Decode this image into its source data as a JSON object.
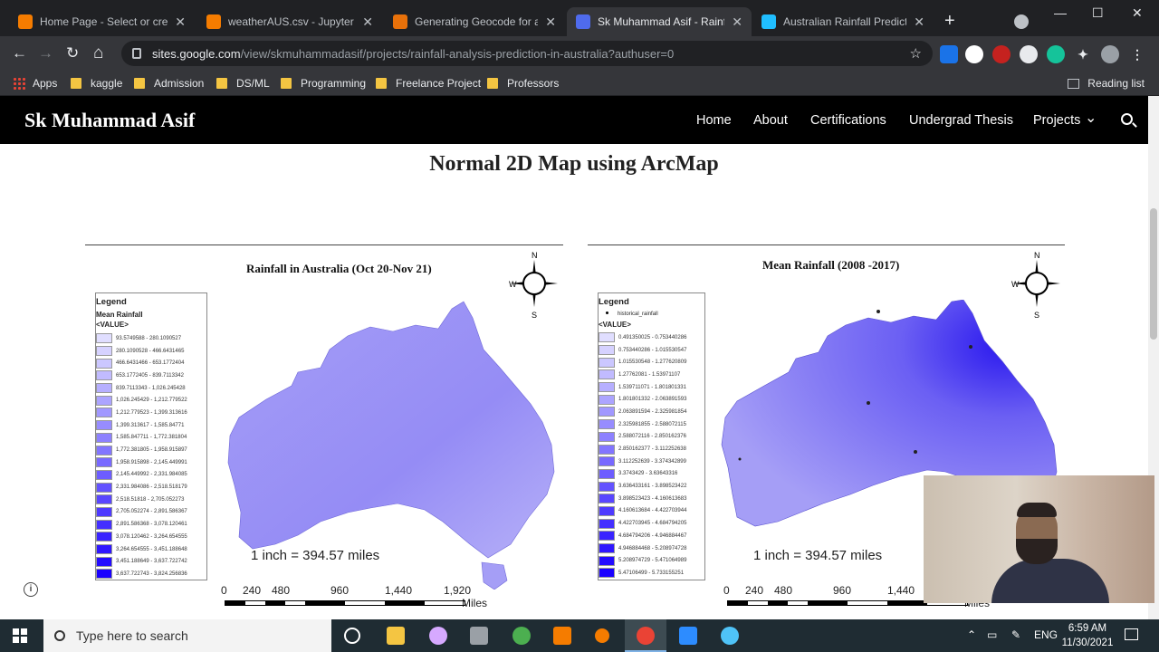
{
  "browser": {
    "tabs": [
      {
        "title": "Home Page - Select or create",
        "fav_color": "#f57c00",
        "active": false
      },
      {
        "title": "weatherAUS.csv - Jupyter Tex",
        "fav_color": "#f57c00",
        "active": false
      },
      {
        "title": "Generating Geocode for aust",
        "fav_color": "#e8710a",
        "active": false
      },
      {
        "title": "Sk Muhammad Asif - Rainfall",
        "fav_color": "#4f6bed",
        "active": true
      },
      {
        "title": "Australian Rainfall Prediction",
        "fav_color": "#20beff",
        "active": false
      }
    ],
    "url_host": "sites.google.com",
    "url_path": "/view/skmuhammadasif/projects/rainfall-analysis-prediction-in-australia?authuser=0",
    "bookmarks": [
      "Apps",
      "kaggle",
      "Admission",
      "DS/ML",
      "Programming",
      "Freelance Project",
      "Professors"
    ],
    "reading_list": "Reading list",
    "icons": {
      "back": "←",
      "forward": "→",
      "reload": "↻",
      "home": "⌂",
      "star": "☆",
      "close": "✕",
      "new_tab": "+",
      "minimize": "—",
      "maximize": "☐"
    }
  },
  "site": {
    "name": "Sk Muhammad Asif",
    "nav": [
      "Home",
      "About",
      "Certifications",
      "Undergrad Thesis",
      "Projects"
    ],
    "nav_projects_caret": "⌄",
    "heading": "Normal 2D Map using ArcMap"
  },
  "maps": {
    "left": {
      "title": "Rainfall in Australia (Oct 20-Nov 21)",
      "legend_title": "Legend",
      "legend_layer": "Mean Rainfall",
      "legend_field": "<VALUE>",
      "classes": [
        "93.5749588 - 280.1090527",
        "280.1090528 - 466.6431465",
        "466.6431466 - 653.1772404",
        "653.1772405 - 839.7113342",
        "839.7113343 - 1,026.245428",
        "1,026.245429 - 1,212.779522",
        "1,212.779523 - 1,399.313616",
        "1,399.313617 - 1,585.84771",
        "1,585.847711 - 1,772.381804",
        "1,772.381805 - 1,958.915897",
        "1,958.915898 - 2,145.449991",
        "2,145.449992 - 2,331.984085",
        "2,331.984086 - 2,518.518179",
        "2,518.51818 - 2,705.052273",
        "2,705.052274 - 2,891.586367",
        "2,891.586368 - 3,078.120461",
        "3,078.120462 - 3,264.654555",
        "3,264.654555 - 3,451.188648",
        "3,451.188649 - 3,637.722742",
        "3,637.722743 - 3,824.256836"
      ],
      "scale_text": "1 inch = 394.57 miles",
      "ticks": [
        "0",
        "240",
        "480",
        "960",
        "1,440",
        "1,920"
      ],
      "unit": "Miles"
    },
    "right": {
      "title": "Mean Rainfall (2008 -2017)",
      "legend_title": "Legend",
      "legend_point": "historical_rainfall",
      "legend_field": "<VALUE>",
      "classes": [
        "0.491350025 - 0.753440286",
        "0.753440286 - 1.015530547",
        "1.015530548 - 1.277620809",
        "1.27762081 - 1.53971107",
        "1.539711071 - 1.801801331",
        "1.801801332 - 2.063891593",
        "2.063891594 - 2.325981854",
        "2.325981855 - 2.588072115",
        "2.588072116 - 2.850162376",
        "2.850162377 - 3.112252638",
        "3.112252639 - 3.374342899",
        "3.3743429 - 3.63643316",
        "3.636433161 - 3.898523422",
        "3.898523423 - 4.160613683",
        "4.160613684 - 4.422703944",
        "4.422703945 - 4.684794205",
        "4.684794206 - 4.946884467",
        "4.946884468 - 5.208974728",
        "5.208974729 - 5.471064989",
        "5.47106499 - 5.733155251"
      ],
      "scale_text": "1 inch = 394.57 miles",
      "ticks": [
        "0",
        "240",
        "480",
        "960",
        "1,440"
      ],
      "unit": "Miles"
    },
    "compass": {
      "n": "N",
      "s": "S",
      "w": "W"
    }
  },
  "taskbar": {
    "search_placeholder": "Type here to search",
    "lang": "ENG",
    "time": "6:59 AM",
    "date": "11/30/2021"
  },
  "colors": {
    "ramp_light": "#e0deff",
    "ramp_dark": "#1a00ff",
    "land_left": "#9f98f5",
    "land_right": "#8a82f4"
  }
}
